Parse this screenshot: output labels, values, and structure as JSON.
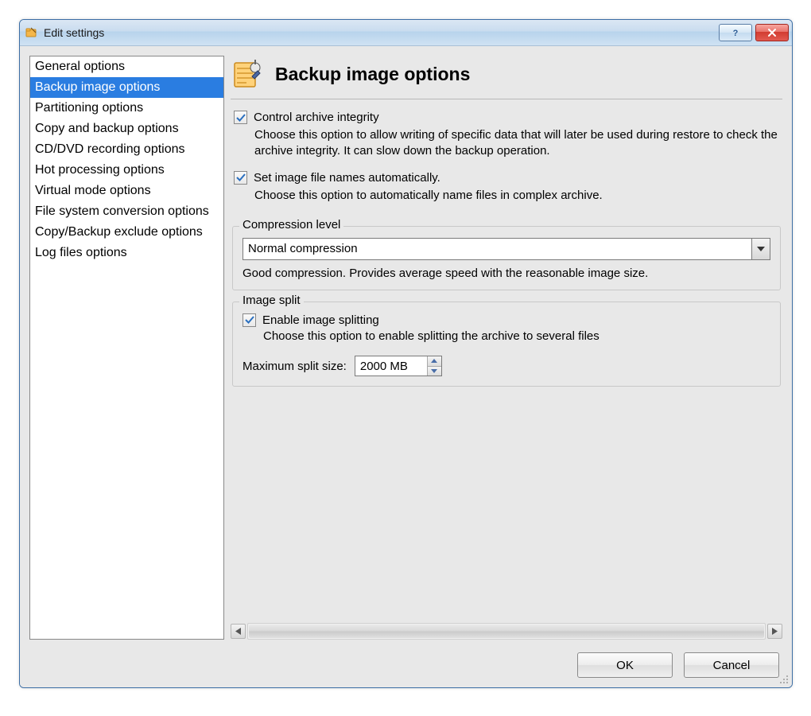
{
  "window": {
    "title": "Edit settings"
  },
  "sidebar": {
    "items": [
      {
        "label": "General options",
        "selected": false
      },
      {
        "label": "Backup image options",
        "selected": true
      },
      {
        "label": "Partitioning options",
        "selected": false
      },
      {
        "label": "Copy and backup options",
        "selected": false
      },
      {
        "label": "CD/DVD recording options",
        "selected": false
      },
      {
        "label": "Hot processing options",
        "selected": false
      },
      {
        "label": "Virtual mode options",
        "selected": false
      },
      {
        "label": "File system conversion options",
        "selected": false
      },
      {
        "label": "Copy/Backup exclude options",
        "selected": false
      },
      {
        "label": "Log files options",
        "selected": false
      }
    ]
  },
  "page": {
    "title": "Backup image options",
    "opt1": {
      "label": "Control archive integrity",
      "checked": true,
      "desc": "Choose this option to allow writing of specific data that will later be used during restore to check the archive integrity. It can slow down the backup operation."
    },
    "opt2": {
      "label": "Set image file names automatically.",
      "checked": true,
      "desc": "Choose this option to automatically name files in complex archive."
    },
    "compression": {
      "legend": "Compression level",
      "value": "Normal compression",
      "desc": "Good compression. Provides average speed with the reasonable image size."
    },
    "split": {
      "legend": "Image split",
      "enable_label": "Enable image splitting",
      "enable_checked": true,
      "enable_desc": "Choose this option to enable splitting the archive to several files",
      "max_label": "Maximum split size:",
      "max_value": "2000 MB"
    }
  },
  "footer": {
    "ok": "OK",
    "cancel": "Cancel"
  }
}
